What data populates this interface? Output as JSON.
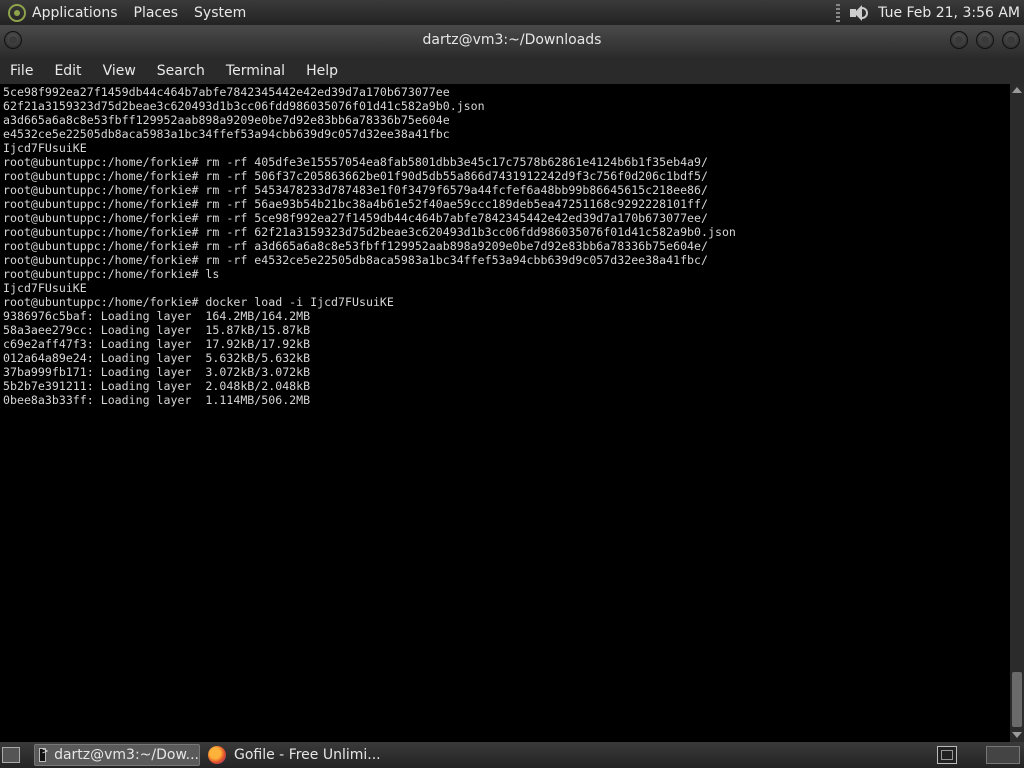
{
  "top_panel": {
    "menus": [
      "Applications",
      "Places",
      "System"
    ],
    "clock": "Tue Feb 21,  3:56 AM"
  },
  "window": {
    "title": "dartz@vm3:~/Downloads"
  },
  "menu_bar": [
    "File",
    "Edit",
    "View",
    "Search",
    "Terminal",
    "Help"
  ],
  "terminal": {
    "lines": [
      "5ce98f992ea27f1459db44c464b7abfe7842345442e42ed39d7a170b673077ee",
      "62f21a3159323d75d2beae3c620493d1b3cc06fdd986035076f01d41c582a9b0.json",
      "a3d665a6a8c8e53fbff129952aab898a9209e0be7d92e83bb6a78336b75e604e",
      "e4532ce5e22505db8aca5983a1bc34ffef53a94cbb639d9c057d32ee38a41fbc",
      "Ijcd7FUsuiKE",
      "root@ubuntuppc:/home/forkie# rm -rf 405dfe3e15557054ea8fab5801dbb3e45c17c7578b62861e4124b6b1f35eb4a9/",
      "root@ubuntuppc:/home/forkie# rm -rf 506f37c205863662be01f90d5db55a866d7431912242d9f3c756f0d206c1bdf5/",
      "root@ubuntuppc:/home/forkie# rm -rf 5453478233d787483e1f0f3479f6579a44fcfef6a48bb99b86645615c218ee86/",
      "root@ubuntuppc:/home/forkie# rm -rf 56ae93b54b21bc38a4b61e52f40ae59ccc189deb5ea47251168c9292228101ff/",
      "root@ubuntuppc:/home/forkie# rm -rf 5ce98f992ea27f1459db44c464b7abfe7842345442e42ed39d7a170b673077ee/",
      "root@ubuntuppc:/home/forkie# rm -rf 62f21a3159323d75d2beae3c620493d1b3cc06fdd986035076f01d41c582a9b0.json",
      "root@ubuntuppc:/home/forkie# rm -rf a3d665a6a8c8e53fbff129952aab898a9209e0be7d92e83bb6a78336b75e604e/",
      "root@ubuntuppc:/home/forkie# rm -rf e4532ce5e22505db8aca5983a1bc34ffef53a94cbb639d9c057d32ee38a41fbc/",
      "root@ubuntuppc:/home/forkie# ls",
      "Ijcd7FUsuiKE",
      "root@ubuntuppc:/home/forkie# docker load -i Ijcd7FUsuiKE",
      "9386976c5baf: Loading layer  164.2MB/164.2MB",
      "58a3aee279cc: Loading layer  15.87kB/15.87kB",
      "c69e2aff47f3: Loading layer  17.92kB/17.92kB",
      "012a64a89e24: Loading layer  5.632kB/5.632kB",
      "37ba999fb171: Loading layer  3.072kB/3.072kB",
      "5b2b7e391211: Loading layer  2.048kB/2.048kB",
      "0bee8a3b33ff: Loading layer  1.114MB/506.2MB"
    ],
    "scroll_position": 0.93
  },
  "taskbar": {
    "tasks": [
      {
        "label": "dartz@vm3:~/Dow...",
        "icon": "terminal-icon",
        "active": true
      },
      {
        "label": "Gofile - Free Unlimi...",
        "icon": "firefox-icon",
        "active": false
      }
    ]
  }
}
